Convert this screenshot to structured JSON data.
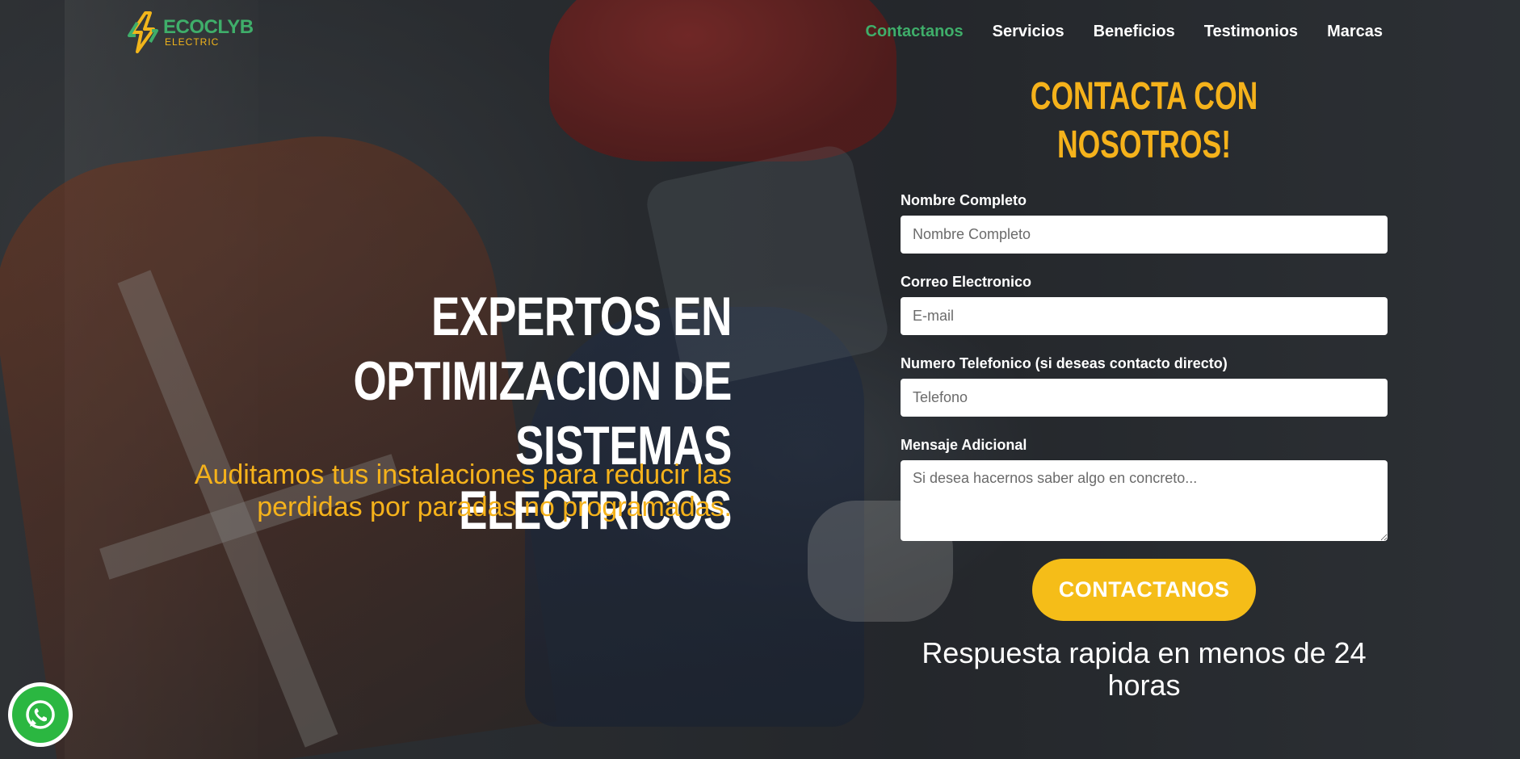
{
  "brand": {
    "name": "ECOCLYB",
    "sub": "ELECTRIC",
    "colors": {
      "green": "#3fae6a",
      "yellow": "#f5b21b"
    }
  },
  "nav": {
    "items": [
      {
        "label": "Contactanos",
        "active": true
      },
      {
        "label": "Servicios"
      },
      {
        "label": "Beneficios"
      },
      {
        "label": "Testimonios"
      },
      {
        "label": "Marcas"
      }
    ]
  },
  "hero": {
    "title_line1": "EXPERTOS EN OPTIMIZACION DE",
    "title_line2": "SISTEMAS ELECTRICOS",
    "subtitle_line1": "Auditamos tus instalaciones para reducir las",
    "subtitle_line2": "perdidas por paradas no programadas."
  },
  "form": {
    "title": "CONTACTA CON NOSOTROS!",
    "name_label": "Nombre Completo",
    "name_placeholder": "Nombre Completo",
    "email_label": "Correo Electronico",
    "email_placeholder": "E-mail",
    "phone_label": "Numero Telefonico (si deseas contacto directo)",
    "phone_placeholder": "Telefono",
    "message_label": "Mensaje Adicional",
    "message_placeholder": "Si desea hacernos saber algo en concreto...",
    "submit_label": "CONTACTANOS",
    "note": "Respuesta rapida en menos de 24 horas"
  },
  "icons": {
    "logo": "lightning-bolt-logo-icon",
    "whatsapp": "whatsapp-icon"
  }
}
